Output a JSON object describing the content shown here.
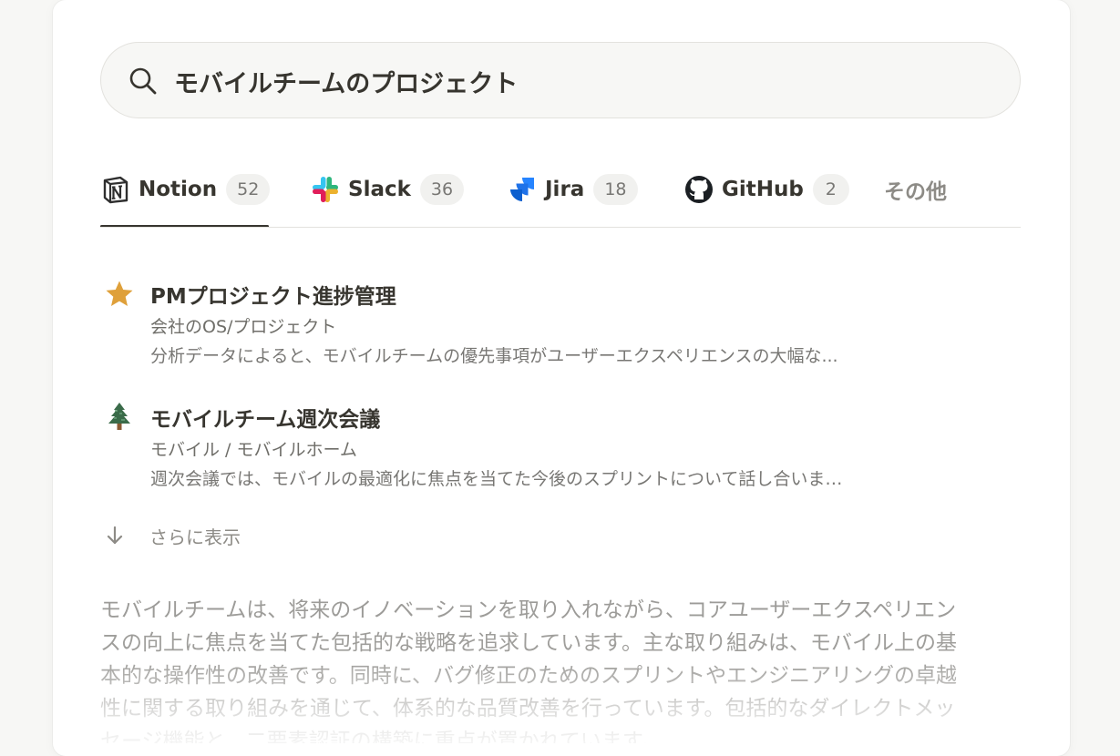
{
  "search": {
    "query": "モバイルチームのプロジェクト",
    "icon": "search-icon"
  },
  "tabs": [
    {
      "label": "Notion",
      "count": "52",
      "icon": "notion-logo-icon",
      "active": true
    },
    {
      "label": "Slack",
      "count": "36",
      "icon": "slack-logo-icon",
      "active": false
    },
    {
      "label": "Jira",
      "count": "18",
      "icon": "jira-logo-icon",
      "active": false
    },
    {
      "label": "GitHub",
      "count": "2",
      "icon": "github-logo-icon",
      "active": false
    },
    {
      "label": "その他",
      "count": "",
      "icon": "",
      "active": false
    }
  ],
  "results": [
    {
      "icon": "star-icon",
      "title": "PMプロジェクト進捗管理",
      "path": "会社のOS/プロジェクト",
      "snippet": "分析データによると、モバイルチームの優先事項がユーザーエクスペリエンスの大幅な..."
    },
    {
      "icon": "evergreen-tree-icon",
      "title": "モバイルチーム週次会議",
      "path": "モバイル / モバイルホーム",
      "snippet": "週次会議では、モバイルの最適化に焦点を当てた今後のスプリントについて話し合いま…"
    }
  ],
  "show_more": {
    "label": "さらに表示",
    "icon": "arrow-down-icon"
  },
  "summary": {
    "lines": [
      "モバイルチームは、将来のイノベーションを取り入れながら、コアユーザーエクスペリエン",
      "スの向上に焦点を当てた包括的な戦略を追求しています。主な取り組みは、モバイル上の基",
      "本的な操作性の改善です。同時に、バグ修正のためのスプリントやエンジニアリングの卓越",
      "性に関する取り組みを通じて、体系的な品質改善を行っています。包括的なダイレクトメッ",
      "セージ機能と、二要素認証の構築に重点が置かれています。"
    ]
  },
  "colors": {
    "text": "#37352f",
    "muted": "#787774",
    "badge_bg": "#f1f1ef",
    "search_bg": "#f7f7f5",
    "star": "#dfa03a",
    "tree": "#3a6b49"
  }
}
